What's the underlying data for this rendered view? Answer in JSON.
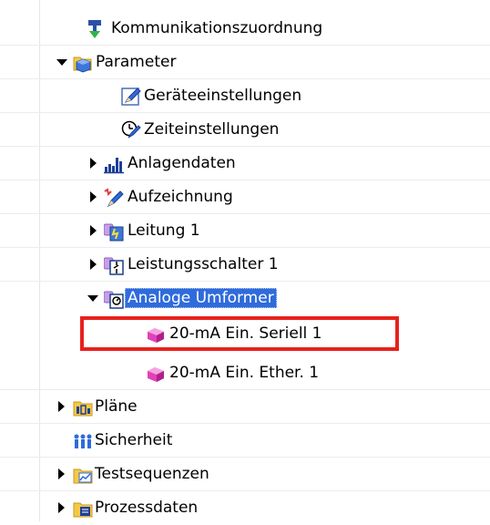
{
  "tree": {
    "kommunikation": {
      "label": "Kommunikationszuordnung",
      "icon": "communication-assignment-icon"
    },
    "parameter": {
      "label": "Parameter",
      "icon": "parameter-folder-icon",
      "expanded": true
    },
    "geraeteeinstellungen": {
      "label": "Geräteeinstellungen",
      "icon": "pencil-settings-icon"
    },
    "zeiteinstellungen": {
      "label": "Zeiteinstellungen",
      "icon": "clock-settings-icon"
    },
    "anlagendaten": {
      "label": "Anlagendaten",
      "icon": "bar-chart-icon",
      "expanded": false
    },
    "aufzeichnung": {
      "label": "Aufzeichnung",
      "icon": "recording-icon",
      "expanded": false
    },
    "leitung": {
      "label": "Leitung 1",
      "icon": "line-function-icon",
      "expanded": false
    },
    "leistungsschalter": {
      "label": "Leistungsschalter 1",
      "icon": "circuit-breaker-icon",
      "expanded": false
    },
    "analoge_umformer": {
      "label": "Analoge Umformer",
      "icon": "transducer-icon",
      "expanded": true,
      "selected": true
    },
    "seriell": {
      "label": "20-mA Ein. Seriell 1",
      "icon": "pink-cube-icon",
      "highlighted": true
    },
    "ether": {
      "label": "20-mA Ein. Ether. 1",
      "icon": "pink-cube-icon"
    },
    "plaene": {
      "label": "Pläne",
      "icon": "charts-folder-icon",
      "expanded": false
    },
    "sicherheit": {
      "label": "Sicherheit",
      "icon": "security-users-icon"
    },
    "testsequenzen": {
      "label": "Testsequenzen",
      "icon": "test-sequence-folder-icon",
      "expanded": false
    },
    "prozessdaten": {
      "label": "Prozessdaten",
      "icon": "process-data-folder-icon",
      "expanded": false
    }
  },
  "colors": {
    "selection": "#2f6bdc",
    "highlight_border": "#e8211d",
    "pink": "#e040b8"
  }
}
